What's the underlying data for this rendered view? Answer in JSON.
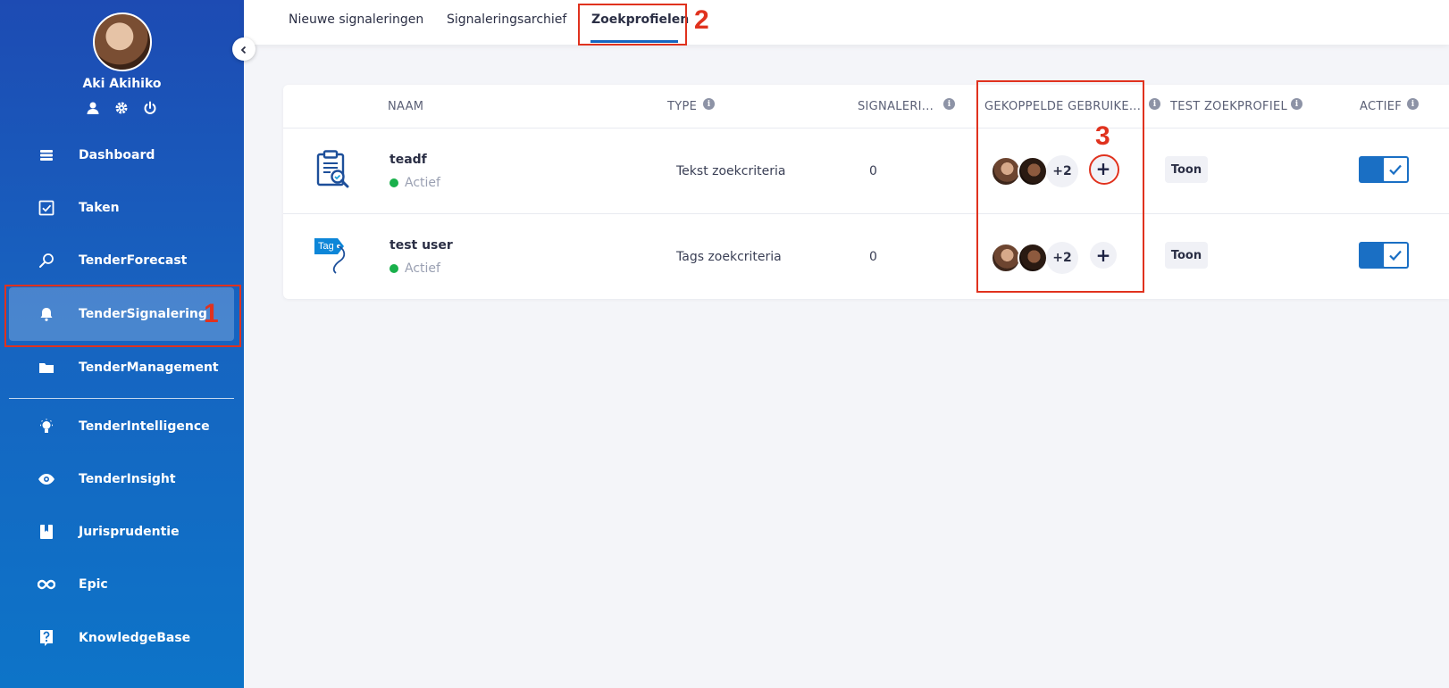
{
  "sidebar": {
    "user_name": "Aki Akihiko",
    "user_icons": [
      "user-icon",
      "gear-icon",
      "power-icon"
    ],
    "items": [
      {
        "label": "Dashboard",
        "icon": "stack-icon"
      },
      {
        "label": "Taken",
        "icon": "checkbox-icon"
      },
      {
        "label": "TenderForecast",
        "icon": "search-icon"
      },
      {
        "label": "TenderSignalering",
        "icon": "bell-icon",
        "active": true
      },
      {
        "label": "TenderManagement",
        "icon": "folder-icon"
      },
      {
        "label": "TenderIntelligence",
        "icon": "lightbulb-icon"
      },
      {
        "label": "TenderInsight",
        "icon": "eye-icon"
      },
      {
        "label": "Jurisprudentie",
        "icon": "bookmark-icon"
      },
      {
        "label": "Epic",
        "icon": "infinity-icon"
      },
      {
        "label": "KnowledgeBase",
        "icon": "question-icon"
      }
    ]
  },
  "tabs": [
    {
      "label": "Nieuwe signaleringen"
    },
    {
      "label": "Signaleringsarchief"
    },
    {
      "label": "Zoekprofielen",
      "active": true
    }
  ],
  "table": {
    "headers": {
      "name": "NAAM",
      "type": "TYPE",
      "signaleringen": "SIGNALERI...",
      "users": "GEKOPPELDE GEBRUIKE...",
      "test": "TEST ZOEKPROFIEL",
      "active": "ACTIEF"
    },
    "rows": [
      {
        "name": "teadf",
        "status": "Actief",
        "type": "Tekst zoekcriteria",
        "count": "0",
        "more_users": "+2",
        "test_label": "Toon",
        "active": true,
        "icon": "clipboard-search-icon"
      },
      {
        "name": "test user",
        "status": "Actief",
        "type": "Tags zoekcriteria",
        "count": "0",
        "more_users": "+2",
        "test_label": "Toon",
        "active": true,
        "icon": "tag-icon",
        "icon_text": "Tag"
      }
    ]
  },
  "annotations": {
    "n1": "1",
    "n2": "2",
    "n3": "3"
  },
  "colors": {
    "accent": "#1565c0",
    "annotation": "#e0321e",
    "status_active": "#19b04b"
  }
}
